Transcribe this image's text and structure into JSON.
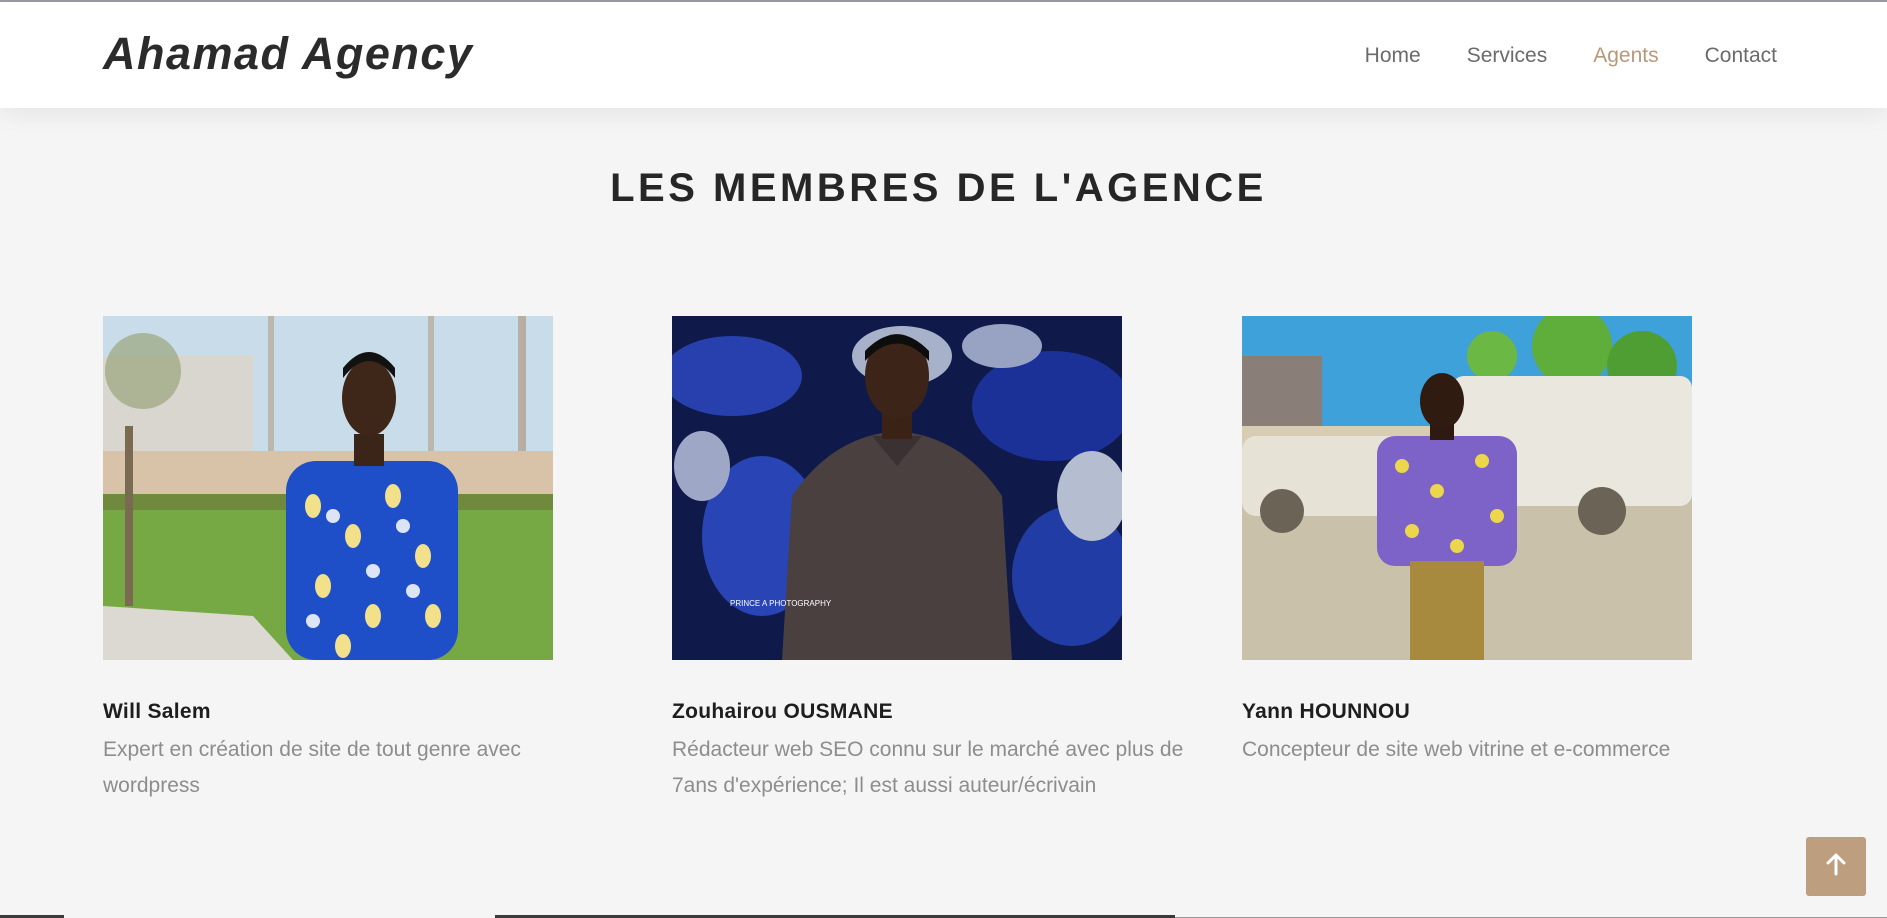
{
  "header": {
    "logo": "Ahamad Agency",
    "nav": [
      {
        "label": "Home",
        "active": false
      },
      {
        "label": "Services",
        "active": false
      },
      {
        "label": "Agents",
        "active": true
      },
      {
        "label": "Contact",
        "active": false
      }
    ]
  },
  "section": {
    "title": "LES MEMBRES DE L'AGENCE"
  },
  "members": [
    {
      "name": "Will Salem",
      "description": "Expert en création de site de tout genre avec wordpress"
    },
    {
      "name": "Zouhairou OUSMANE",
      "description": "Rédacteur web SEO connu sur le marché avec plus de 7ans d'expérience; Il est aussi auteur/écrivain"
    },
    {
      "name": "Yann HOUNNOU",
      "description": "Concepteur de site web vitrine et e-commerce"
    }
  ],
  "photo_watermark": "PRINCE A PHOTOGRAPHY",
  "colors": {
    "accent": "#bd9f7f",
    "active_nav": "#b9987a",
    "page_bg": "#f6f5f5"
  },
  "icons": {
    "scroll_top": "arrow-up-icon"
  }
}
